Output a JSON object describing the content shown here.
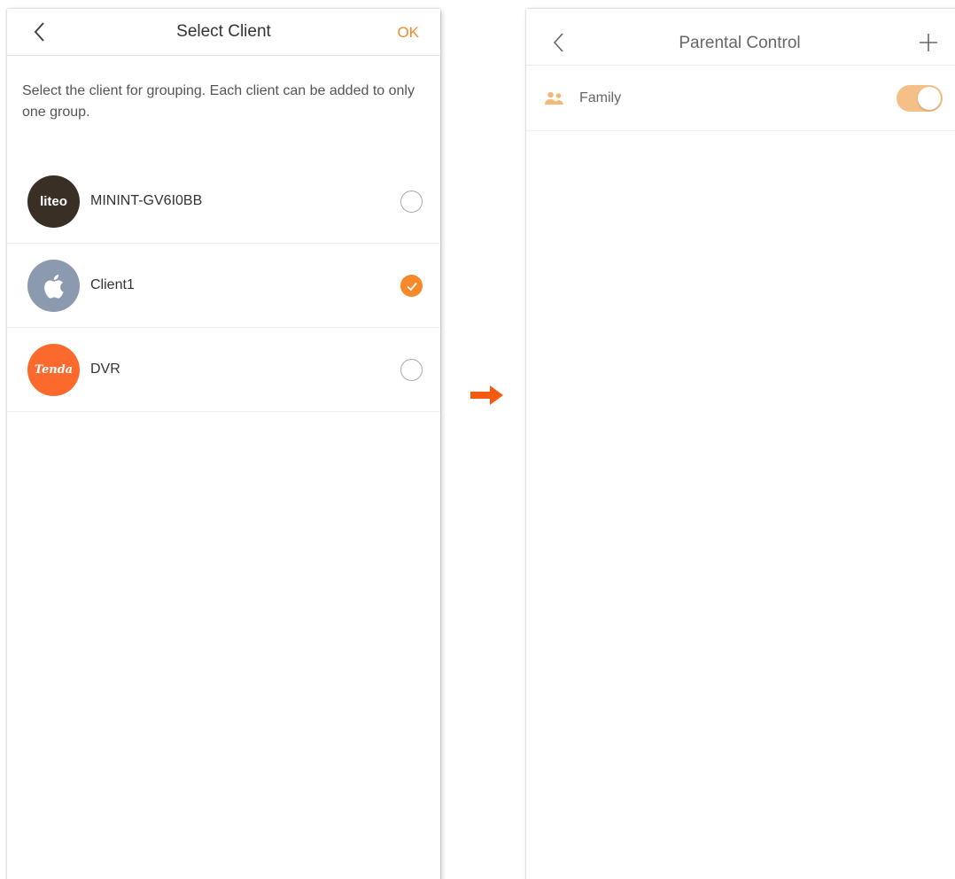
{
  "left_screen": {
    "title": "Select Client",
    "ok_label": "OK",
    "description": "Select the client for grouping. Each client can be added to only one group.",
    "clients": [
      {
        "name": "MININT-GV6I0BB",
        "avatar_text": "liteo",
        "avatar_icon": "liteo-logo",
        "selected": false
      },
      {
        "name": "Client1",
        "avatar_text": "",
        "avatar_icon": "apple-icon",
        "selected": true
      },
      {
        "name": "DVR",
        "avatar_text": "Tenda",
        "avatar_icon": "tenda-logo",
        "selected": false
      }
    ]
  },
  "right_screen": {
    "title": "Parental Control",
    "groups": [
      {
        "name": "Family",
        "icon": "group-icon",
        "enabled": true
      }
    ]
  },
  "colors": {
    "accent": "#f7892a",
    "toggle_on": "#f5c088",
    "arrow": "#f45a12"
  }
}
